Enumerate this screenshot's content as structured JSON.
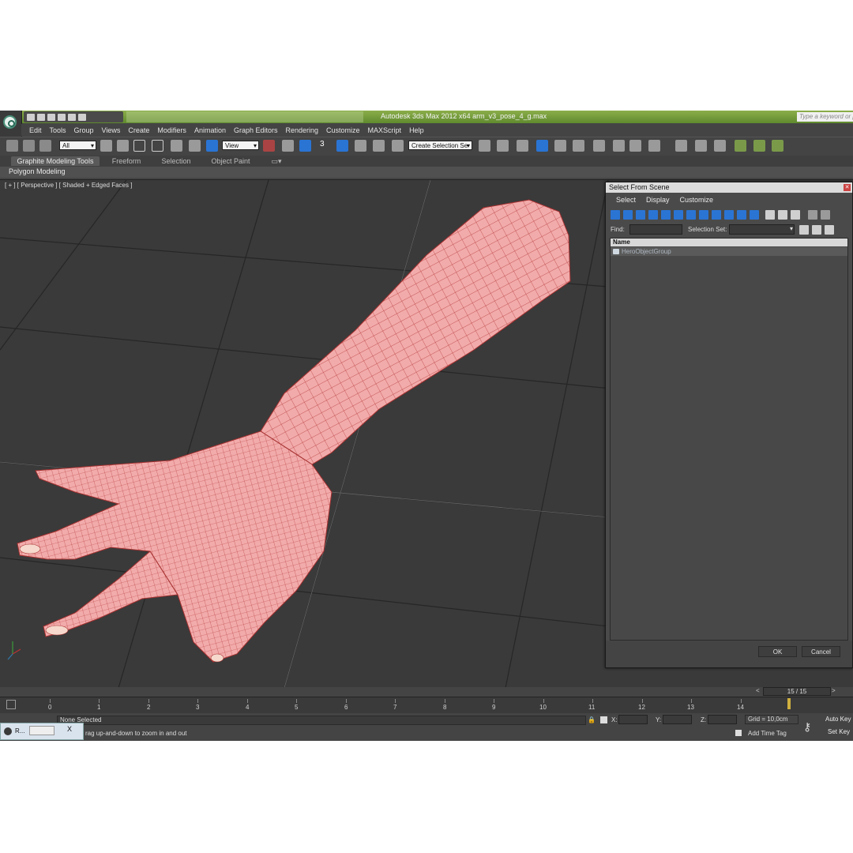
{
  "window": {
    "title": "Autodesk 3ds Max  2012 x64     arm_v3_pose_4_g.max",
    "search_placeholder": "Type a keyword or phrase"
  },
  "menu": [
    "Edit",
    "Tools",
    "Group",
    "Views",
    "Create",
    "Modifiers",
    "Animation",
    "Graph Editors",
    "Rendering",
    "Customize",
    "MAXScript",
    "Help"
  ],
  "toolbar": {
    "selection_filter": "All",
    "reference_coord": "View",
    "named_selection": "Create Selection Se",
    "snap_toggle_label": "3"
  },
  "ribbon": {
    "tabs": [
      "Graphite Modeling Tools",
      "Freeform",
      "Selection",
      "Object Paint"
    ],
    "panel_label": "Polygon Modeling"
  },
  "viewport": {
    "label": "[ + ] [ Perspective ] [ Shaded + Edged Faces ]"
  },
  "dialog": {
    "title": "Select From Scene",
    "menu": [
      "Select",
      "Display",
      "Customize"
    ],
    "find_label": "Find:",
    "selection_set_label": "Selection Set:",
    "column_header": "Name",
    "items": [
      "HeroObjectGroup"
    ],
    "ok": "OK",
    "cancel": "Cancel"
  },
  "timeline": {
    "frame_counter": "15 / 15",
    "prev": "<",
    "next": ">",
    "ticks": [
      "0",
      "1",
      "2",
      "3",
      "4",
      "5",
      "6",
      "7",
      "8",
      "9",
      "10",
      "11",
      "12",
      "13",
      "14"
    ]
  },
  "status": {
    "selection": "None Selected",
    "prompt": "rag up-and-down to zoom in and out",
    "x_label": "X:",
    "y_label": "Y:",
    "z_label": "Z:",
    "grid": "Grid = 10,0cm",
    "add_time_tag": "Add Time Tag",
    "auto_key": "Auto Key",
    "set_key": "Set Key"
  },
  "taskbar": {
    "item_label": "R...",
    "close": "X"
  },
  "colors": {
    "viewport_bg": "#3a3a3a",
    "mesh_fill": "#f0a8a8",
    "mesh_wire": "#b83a3a",
    "accent_blue": "#2a74d4",
    "title_green": "#6f9a3a"
  }
}
